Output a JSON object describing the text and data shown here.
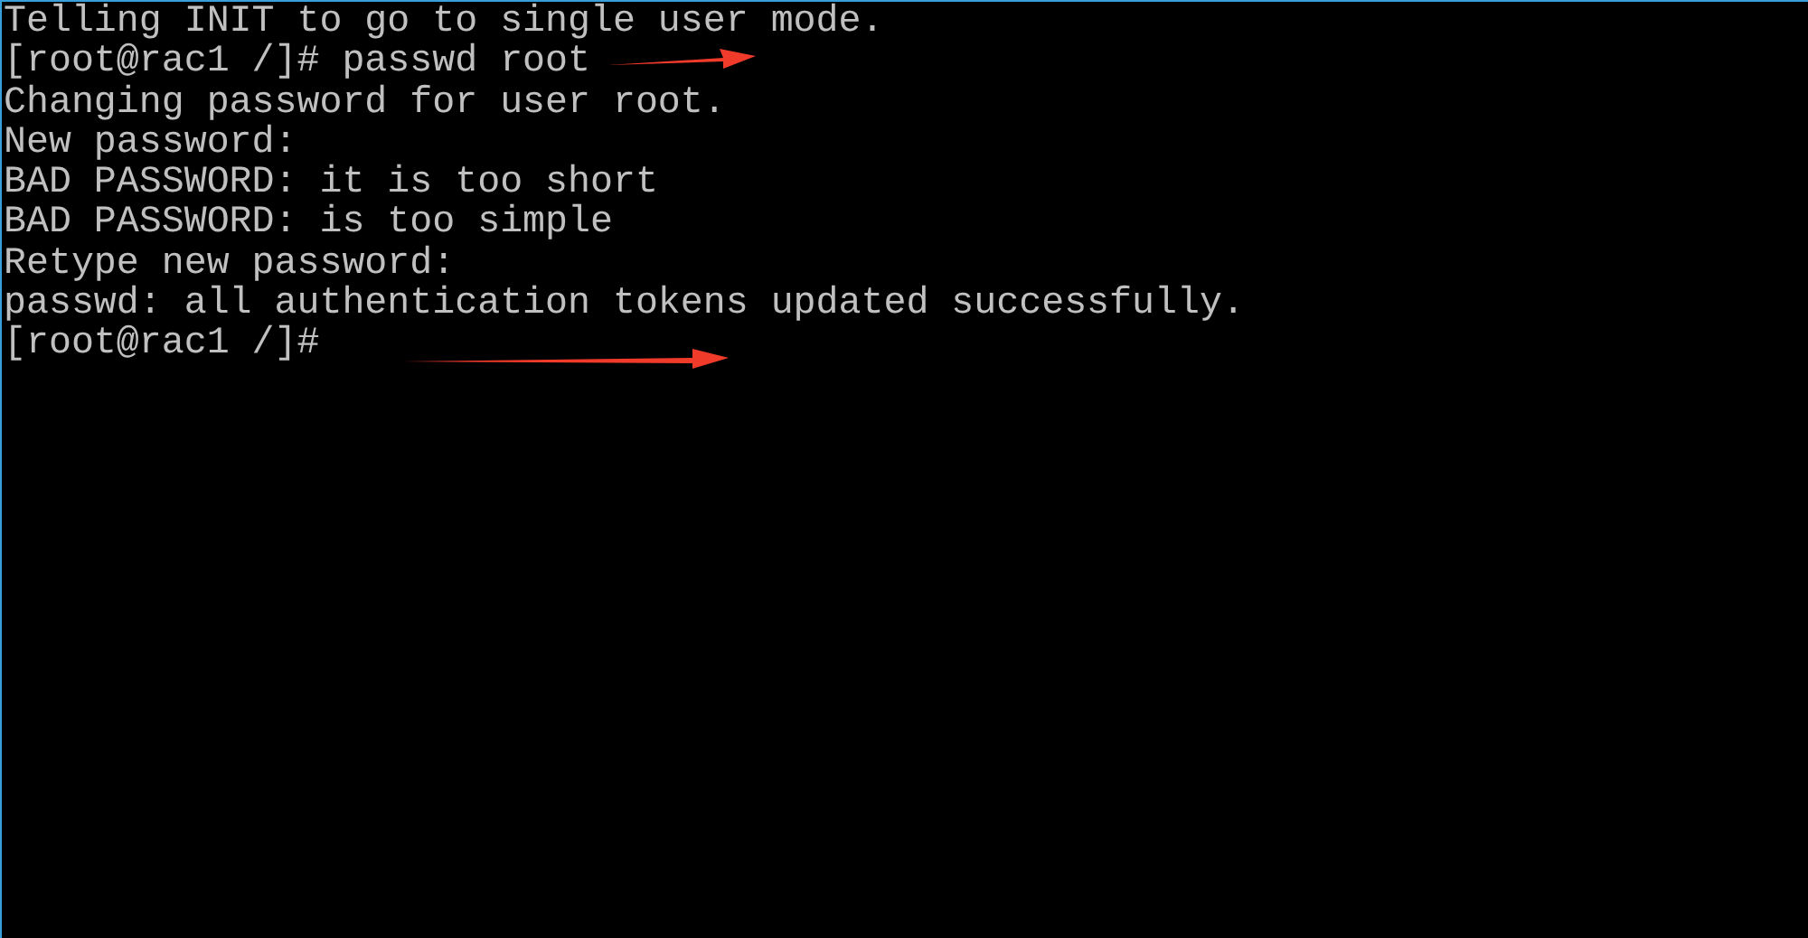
{
  "terminal": {
    "lines": [
      {
        "text": "Telling INIT to go to single user mode.",
        "arrow": false
      },
      {
        "text": "[root@rac1 /]# passwd root",
        "arrow": true
      },
      {
        "text": "Changing password for user root.",
        "arrow": false
      },
      {
        "text": "New password:",
        "arrow": false
      },
      {
        "text": "BAD PASSWORD: it is too short",
        "arrow": false
      },
      {
        "text": "BAD PASSWORD: is too simple",
        "arrow": false
      },
      {
        "text": "Retype new password:",
        "arrow": false
      },
      {
        "text": "passwd: all authentication tokens updated successfully.",
        "arrow": false
      },
      {
        "text": "[root@rac1 /]#",
        "arrow": true
      }
    ]
  }
}
